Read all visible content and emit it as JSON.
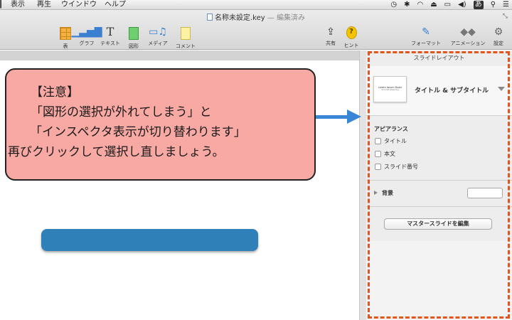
{
  "menubar": {
    "items": [
      "表示",
      "再生",
      "ウインドウ",
      "ヘルプ"
    ],
    "status_icons": [
      "time-machine-icon",
      "bluetooth-icon",
      "wifi-icon",
      "eject-icon",
      "battery-icon",
      "volume-icon",
      "input-method-icon",
      "spotlight-icon",
      "notification-list-icon"
    ],
    "input_method_label": "あ"
  },
  "window": {
    "doc_title": "名称未設定.key",
    "doc_status": " — 編集済み"
  },
  "toolbar": {
    "tools": [
      {
        "label": "表",
        "icon": "table-icon"
      },
      {
        "label": "グラフ",
        "icon": "chart-icon"
      },
      {
        "label": "テキスト",
        "icon": "text-icon"
      },
      {
        "label": "図形",
        "icon": "shape-icon"
      },
      {
        "label": "メディア",
        "icon": "media-icon"
      },
      {
        "label": "コメント",
        "icon": "comment-icon"
      }
    ],
    "share_label": "共有",
    "hint_label": "ヒント",
    "format_label": "フォーマット",
    "animation_label": "アニメーション",
    "settings_label": "設定"
  },
  "callout": {
    "line1": "【注意】",
    "line2": "「図形の選択が外れてしまう」と",
    "line3": "「インスペクタ表示が切り替わります」",
    "line4": "再びクリックして選択し直しましょう。",
    "bg_color": "#f9a9a3",
    "arrow_color": "#3a86d6"
  },
  "inspector": {
    "title": "スライドレイアウト",
    "layout_name": "タイトル & サブタイトル",
    "thumb_title": "Lorem Ipsum Dolor",
    "thumb_subtitle": "Sit Amet Adipiscing",
    "appearance_header": "アピアランス",
    "checkboxes": [
      {
        "label": "タイトル",
        "checked": false
      },
      {
        "label": "本文",
        "checked": false
      },
      {
        "label": "スライド番号",
        "checked": false
      }
    ],
    "background_label": "背景",
    "master_button": "マスタースライドを編集",
    "highlight_color": "#e4551e"
  },
  "canvas": {
    "shape_color": "#2f7fb8"
  }
}
